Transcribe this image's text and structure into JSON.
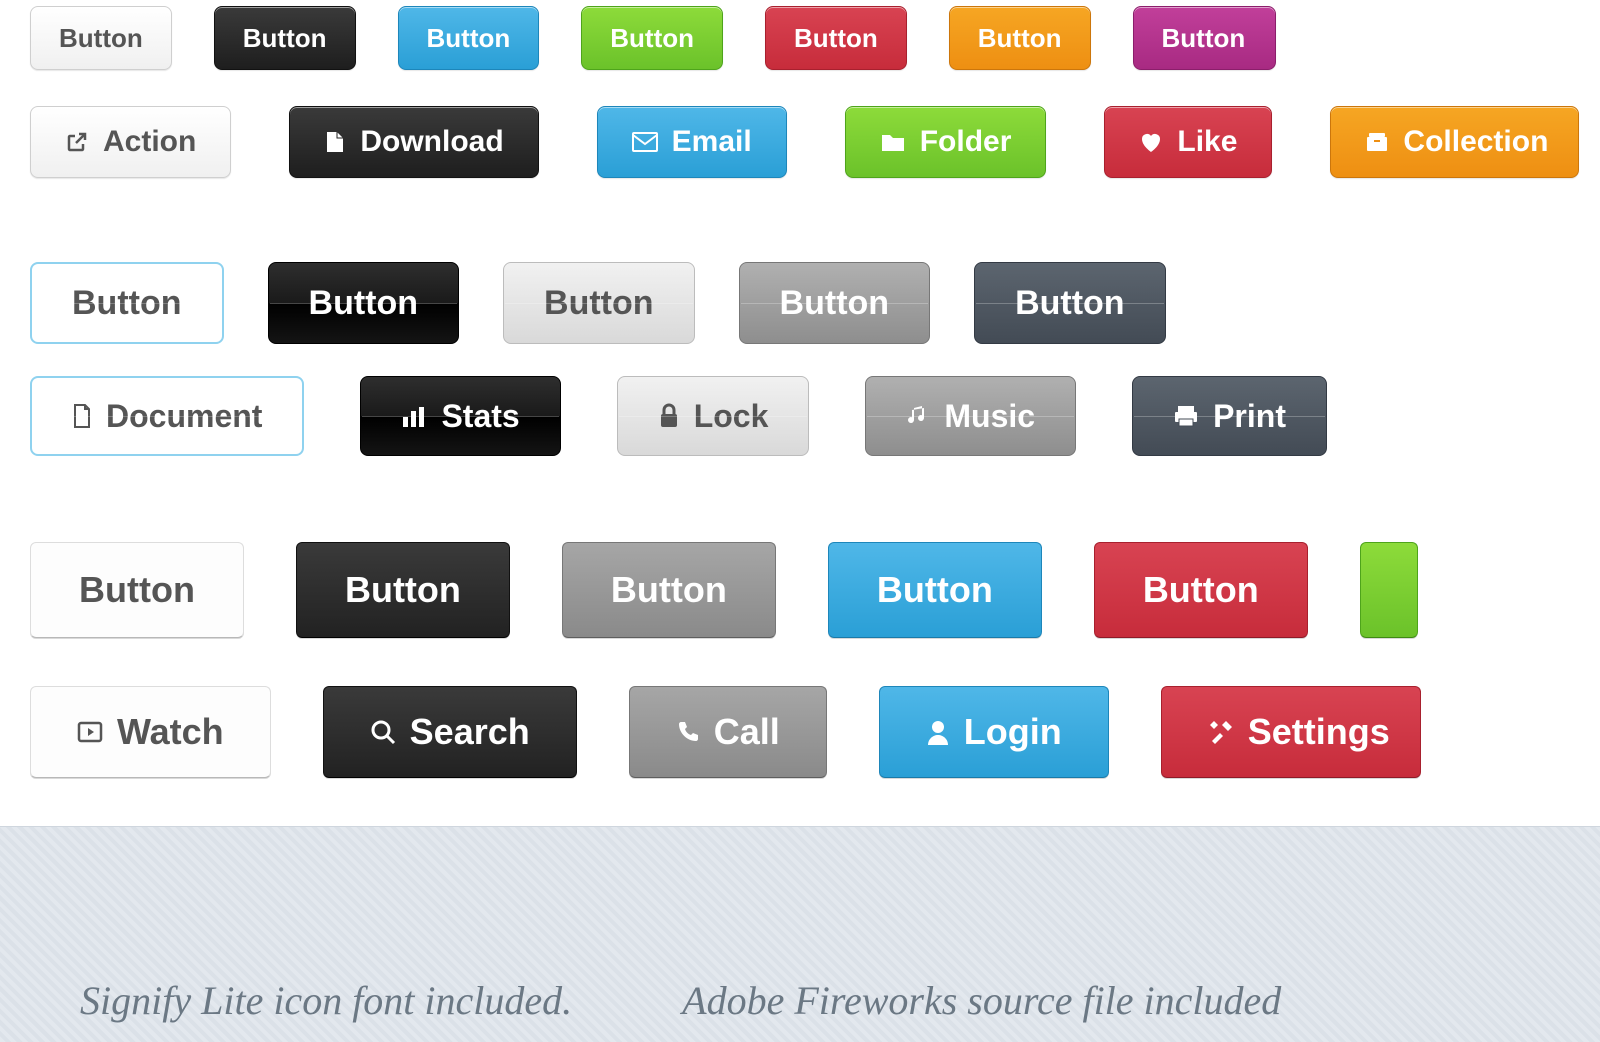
{
  "generic_label": "Button",
  "row2": {
    "action": "Action",
    "download": "Download",
    "email": "Email",
    "folder": "Folder",
    "like": "Like",
    "collection": "Collection"
  },
  "row4": {
    "document": "Document",
    "stats": "Stats",
    "lock": "Lock",
    "music": "Music",
    "print": "Print"
  },
  "row6": {
    "watch": "Watch",
    "search": "Search",
    "call": "Call",
    "login": "Login",
    "settings": "Settings"
  },
  "footer": {
    "left": "Signify Lite icon font included.",
    "right": "Adobe Fireworks source file included"
  },
  "colors": {
    "white": "#f0f0f0",
    "black": "#222222",
    "blue": "#2a9fd6",
    "green": "#6bc22a",
    "red": "#c72c3b",
    "orange": "#ee8f12",
    "magenta": "#a82a82",
    "silver": "#d9d9d9",
    "gray": "#8e8e8e",
    "slate": "#434b55"
  }
}
